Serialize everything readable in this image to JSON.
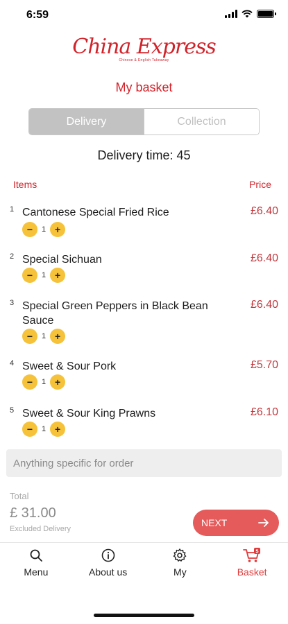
{
  "status_bar": {
    "time": "6:59"
  },
  "brand": {
    "name": "China Express",
    "tagline": "Chinese & English Takeaway"
  },
  "page": {
    "title": "My basket"
  },
  "order_mode": {
    "options": [
      "Delivery",
      "Collection"
    ],
    "selected": "Delivery"
  },
  "delivery": {
    "time_label": "Delivery time: 45"
  },
  "columns": {
    "items": "Items",
    "price": "Price"
  },
  "items": [
    {
      "index": "1",
      "name": "Cantonese Special Fried Rice",
      "qty": "1",
      "price": "£6.40"
    },
    {
      "index": "2",
      "name": "Special Sichuan",
      "qty": "1",
      "price": "£6.40"
    },
    {
      "index": "3",
      "name": "Special Green Peppers in Black Bean Sauce",
      "qty": "1",
      "price": "£6.40"
    },
    {
      "index": "4",
      "name": "Sweet & Sour Pork",
      "qty": "1",
      "price": "£5.70"
    },
    {
      "index": "5",
      "name": "Sweet & Sour King Prawns",
      "qty": "1",
      "price": "£6.10"
    }
  ],
  "qty_controls": {
    "minus": "−",
    "plus": "+"
  },
  "notes": {
    "placeholder": "Anything specific for order"
  },
  "total": {
    "label": "Total",
    "value": "£ 31.00",
    "note": "Excluded Delivery"
  },
  "next_button": {
    "label": "NEXT"
  },
  "tabbar": {
    "tabs": [
      {
        "label": "Menu",
        "icon": "search-icon"
      },
      {
        "label": "About us",
        "icon": "info-icon"
      },
      {
        "label": "My",
        "icon": "gear-icon"
      },
      {
        "label": "Basket",
        "icon": "cart-icon",
        "badge": "5"
      }
    ],
    "active": "Basket"
  },
  "colors": {
    "accent": "#d1232a",
    "qty_button": "#f5c23a",
    "next_button": "#e55a5a"
  }
}
